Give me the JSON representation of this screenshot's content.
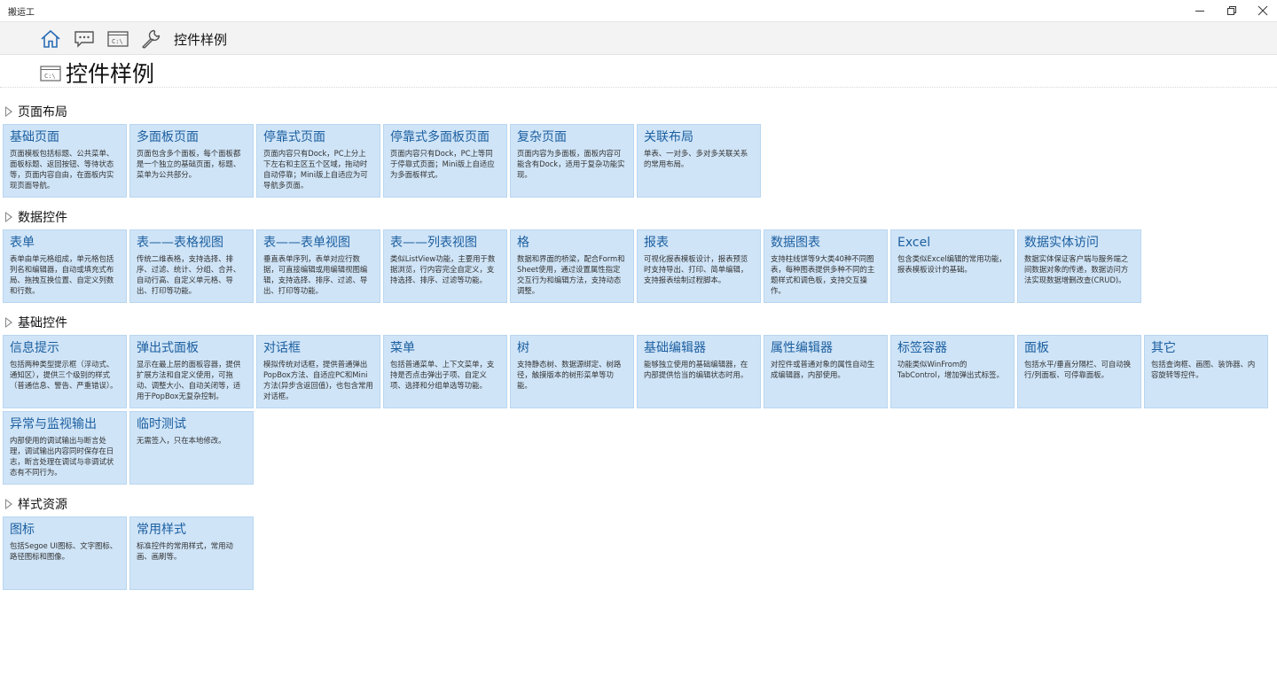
{
  "window": {
    "title": "搬运工"
  },
  "toolbar": {
    "icons": [
      "home-icon",
      "chat-icon",
      "console-icon",
      "wrench-icon"
    ],
    "title": "控件样例"
  },
  "page": {
    "title": "控件样例",
    "icon": "console-icon"
  },
  "sections": [
    {
      "title": "页面布局",
      "items": [
        {
          "title": "基础页面",
          "desc": "页面模板包括标题、公共菜单、面板标题、返回按钮、等待状态等，页面内容自由，在面板内实现页面导航。"
        },
        {
          "title": "多面板页面",
          "desc": "页面包含多个面板，每个面板都是一个独立的基础页面，标题、菜单为公共部分。"
        },
        {
          "title": "停靠式页面",
          "desc": "页面内容只有Dock，PC上分上下左右和主区五个区域，拖动时自动停靠；Mini版上自适应为可导航多页面。"
        },
        {
          "title": "停靠式多面板页面",
          "desc": "页面内容只有Dock，PC上等同于停靠式页面；Mini版上自适应为多面板样式。"
        },
        {
          "title": "复杂页面",
          "desc": "页面内容为多面板，面板内容可能含有Dock，适用于复杂功能实现。"
        },
        {
          "title": "关联布局",
          "desc": "单表、一对多、多对多关联关系的常用布局。"
        }
      ]
    },
    {
      "title": "数据控件",
      "items": [
        {
          "title": "表单",
          "desc": "表单由单元格组成，单元格包括列名和编辑器，自动或填充式布局、拖拽互换位置、自定义列数和行数。"
        },
        {
          "title": "表——表格视图",
          "desc": "传统二维表格，支持选择、排序、过滤、统计、分组、合并、自动行高、自定义单元格、导出、打印等功能。"
        },
        {
          "title": "表——表单视图",
          "desc": "垂直表单序列，表单对应行数据，可直接编辑或用编辑视图编辑，支持选择、排序、过滤、导出、打印等功能。"
        },
        {
          "title": "表——列表视图",
          "desc": "类似ListView功能，主要用于数据浏览，行内容完全自定义，支持选择、排序、过滤等功能。"
        },
        {
          "title": "格",
          "desc": "数据和界面的桥梁，配合Form和Sheet使用，通过设置属性指定交互行为和编辑方法，支持动态调整。"
        },
        {
          "title": "报表",
          "desc": "可视化报表模板设计，报表预览时支持导出、打印、简单编辑，支持报表绘制过程脚本。"
        },
        {
          "title": "数据图表",
          "desc": "支持柱线饼等9大类40种不同图表，每种图表提供多种不同的主题样式和调色板，支持交互操作。"
        },
        {
          "title": "Excel",
          "desc": "包含类似Excel编辑的常用功能，报表模板设计的基础。"
        },
        {
          "title": "数据实体访问",
          "desc": "数据实体保证客户端与服务端之间数据对象的传递，数据访问方法实现数据增删改查(CRUD)。"
        }
      ]
    },
    {
      "title": "基础控件",
      "items": [
        {
          "title": "信息提示",
          "desc": "包括两种类型提示框（浮动式、通知区），提供三个级别的样式（普通信息、警告、严重错误）。"
        },
        {
          "title": "弹出式面板",
          "desc": "显示在最上层的面板容器，提供扩展方法和自定义使用，可拖动、调整大小、自动关闭等，适用于PopBox无复杂控制。"
        },
        {
          "title": "对话框",
          "desc": "模拟传统对话框，提供普通弹出PopBox方法、自适应PC和Mini方法(异步含返回值)，也包含常用对话框。"
        },
        {
          "title": "菜单",
          "desc": "包括普通菜单、上下文菜单，支持是否点击弹出子项、自定义项、选择和分组单选等功能。"
        },
        {
          "title": "树",
          "desc": "支持静态树、数据源绑定、树路径，触摸版本的树形菜单等功能。"
        },
        {
          "title": "基础编辑器",
          "desc": "能够独立使用的基础编辑器，在内部提供恰当的编辑状态时用。"
        },
        {
          "title": "属性编辑器",
          "desc": "对控件或普通对象的属性自动生成编辑器，内部使用。"
        },
        {
          "title": "标签容器",
          "desc": "功能类似WinFrom的TabControl，增加弹出式标签。"
        },
        {
          "title": "面板",
          "desc": "包括水平/垂直分隔栏、可自动换行/列面板、可停靠面板。"
        },
        {
          "title": "其它",
          "desc": "包括查询框、画图、装饰器、内容旋转等控件。"
        },
        {
          "title": "异常与监视输出",
          "desc": "内部使用的调试输出与断言处理，调试输出内容同时保存在日志，断言处理在调试与非调试状态有不同行为。"
        },
        {
          "title": "临时测试",
          "desc": "无需签入，只在本地修改。"
        }
      ]
    },
    {
      "title": "样式资源",
      "items": [
        {
          "title": "图标",
          "desc": "包括Segoe UI图标、文字图标、路径图标和图像。"
        },
        {
          "title": "常用样式",
          "desc": "标准控件的常用样式，常用动画、画刷等。"
        }
      ]
    }
  ]
}
